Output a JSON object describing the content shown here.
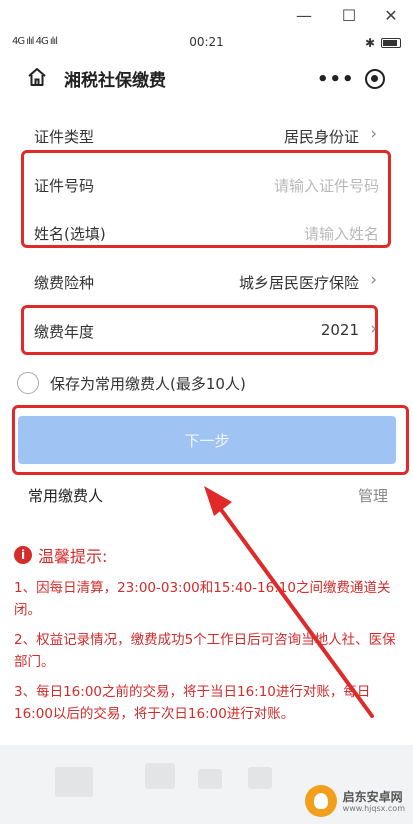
{
  "window": {
    "minimize": "—",
    "maximize": "☐",
    "close": "✕"
  },
  "status_bar": {
    "signal": "4G ılıl 4G ılıl",
    "time": "00:21",
    "bluetooth": "✱"
  },
  "nav": {
    "title": "湘税社保缴费",
    "more": "•••"
  },
  "form": {
    "id_type": {
      "label": "证件类型",
      "value": "居民身份证"
    },
    "id_number": {
      "label": "证件号码",
      "placeholder": "请输入证件号码"
    },
    "name": {
      "label": "姓名(选填)",
      "placeholder": "请输入姓名"
    },
    "insurance": {
      "label": "缴费险种",
      "value": "城乡居民医疗保险"
    },
    "year": {
      "label": "缴费年度",
      "value": "2021"
    }
  },
  "save_payer": {
    "label": "保存为常用缴费人(最多10人)"
  },
  "next_button": {
    "label": "下一步"
  },
  "common_payers": {
    "label": "常用缴费人",
    "manage": "管理"
  },
  "tips": {
    "title": "温馨提示:",
    "items": [
      "1、因每日清算，23:00-03:00和15:40-16:10之间缴费通道关闭。",
      "2、权益记录情况，缴费成功5个工作日后可咨询当地人社、医保部门。",
      "3、每日16:00之前的交易，将于当日16:10进行对账，每日16:00以后的交易，将于次日16:00进行对账。"
    ]
  },
  "watermark": {
    "name": "启东安卓网",
    "url": "www.hjqsx.com"
  },
  "colors": {
    "highlight": "#e02a2a",
    "button": "#9fc3f3",
    "tips": "#d42b2b"
  }
}
